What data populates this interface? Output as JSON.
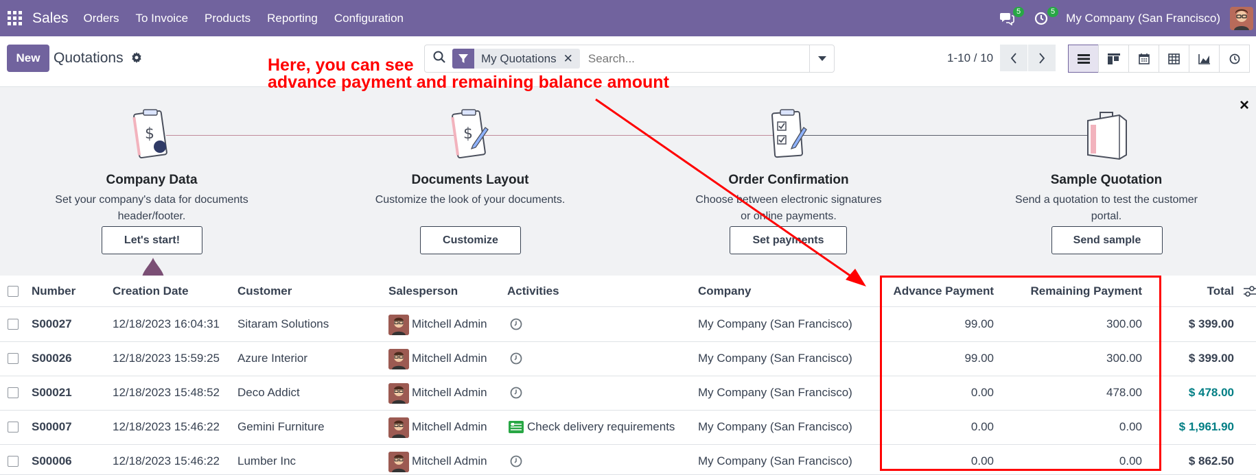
{
  "navbar": {
    "app_name": "Sales",
    "menu": [
      "Orders",
      "To Invoice",
      "Products",
      "Reporting",
      "Configuration"
    ],
    "messages_count": "5",
    "activities_count": "5",
    "company": "My Company (San Francisco)"
  },
  "control_panel": {
    "new_label": "New",
    "title": "Quotations",
    "facet_label": "My Quotations",
    "search_placeholder": "Search...",
    "pager": "1-10 / 10"
  },
  "onboarding": {
    "steps": [
      {
        "title": "Company Data",
        "desc_line1": "Set your company's data for documents",
        "desc_line2": "header/footer.",
        "button": "Let's start!"
      },
      {
        "title": "Documents Layout",
        "desc_line1": "Customize the look of your documents.",
        "desc_line2": "",
        "button": "Customize"
      },
      {
        "title": "Order Confirmation",
        "desc_line1": "Choose between electronic signatures",
        "desc_line2": "or online payments.",
        "button": "Set payments"
      },
      {
        "title": "Sample Quotation",
        "desc_line1": "Send a quotation to test the customer",
        "desc_line2": "portal.",
        "button": "Send sample"
      }
    ],
    "close": "×"
  },
  "table": {
    "headers": {
      "number": "Number",
      "creation_date": "Creation Date",
      "customer": "Customer",
      "salesperson": "Salesperson",
      "activities": "Activities",
      "company": "Company",
      "advance_payment": "Advance Payment",
      "remaining_payment": "Remaining Payment",
      "total": "Total"
    },
    "rows": [
      {
        "number": "S00027",
        "date": "12/18/2023 16:04:31",
        "customer": "Sitaram Solutions",
        "salesperson": "Mitchell Admin",
        "activity": "",
        "company": "My Company (San Francisco)",
        "advance": "99.00",
        "remaining": "300.00",
        "total": "$ 399.00"
      },
      {
        "number": "S00026",
        "date": "12/18/2023 15:59:25",
        "customer": "Azure Interior",
        "salesperson": "Mitchell Admin",
        "activity": "",
        "company": "My Company (San Francisco)",
        "advance": "99.00",
        "remaining": "300.00",
        "total": "$ 399.00"
      },
      {
        "number": "S00021",
        "date": "12/18/2023 15:48:52",
        "customer": "Deco Addict",
        "salesperson": "Mitchell Admin",
        "activity": "",
        "company": "My Company (San Francisco)",
        "advance": "0.00",
        "remaining": "478.00",
        "total": "$ 478.00"
      },
      {
        "number": "S00007",
        "date": "12/18/2023 15:46:22",
        "customer": "Gemini Furniture",
        "salesperson": "Mitchell Admin",
        "activity": "Check delivery requirements",
        "company": "My Company (San Francisco)",
        "advance": "0.00",
        "remaining": "0.00",
        "total": "$ 1,961.90"
      },
      {
        "number": "S00006",
        "date": "12/18/2023 15:46:22",
        "customer": "Lumber Inc",
        "salesperson": "Mitchell Admin",
        "activity": "",
        "company": "My Company (San Francisco)",
        "advance": "0.00",
        "remaining": "0.00",
        "total": "$ 862.50"
      }
    ]
  },
  "annotation": {
    "line1": "Here, you can see",
    "line2": "advance payment and remaining balance amount"
  },
  "colors": {
    "brand": "#71639e",
    "annotation": "#ff0000",
    "teal_total": "#017e84",
    "badge": "#28a745"
  }
}
